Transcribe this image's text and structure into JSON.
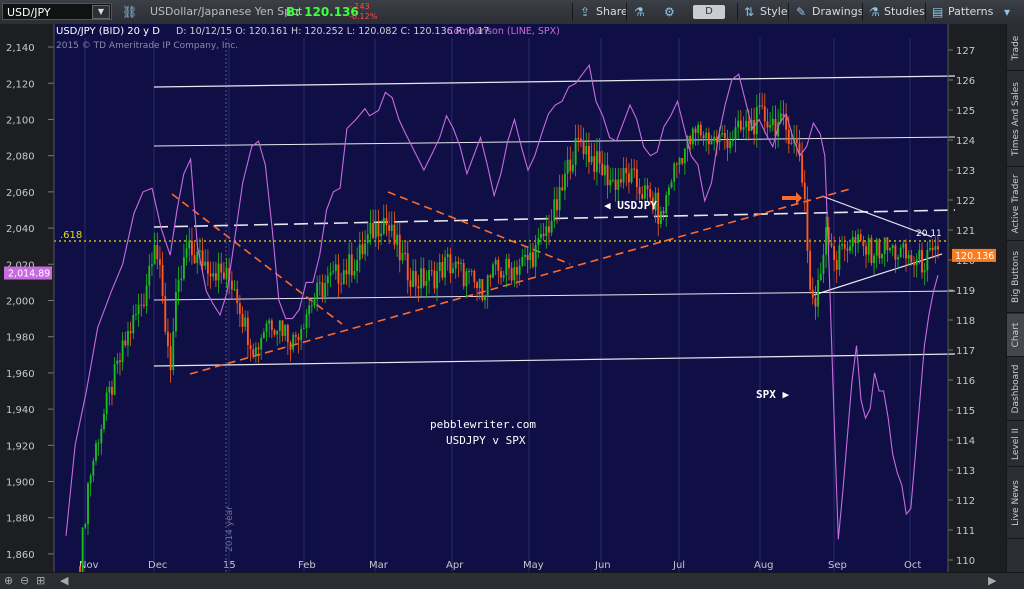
{
  "toolbar": {
    "symbol": "USD/JPY",
    "description": "USDollar/Japanese Yen Spot",
    "bid": "B: 120.136",
    "change_abs": "-.143",
    "change_pct": "-0.12%",
    "share": "Share",
    "period": "D",
    "style": "Style",
    "drawings": "Drawings",
    "studies": "Studies",
    "patterns": "Patterns"
  },
  "sidebar": {
    "tabs": [
      "Trade",
      "Times And Sales",
      "Active Trader",
      "Big Buttons",
      "Chart",
      "Dashboard",
      "Level II",
      "Live News"
    ],
    "active": "Chart"
  },
  "colors": {
    "plot_bg": "#0f0e45",
    "up": "#1bbf1b",
    "down": "#ff5a1a",
    "comparison": "#c86be0",
    "trend_red": "#ff6a2a",
    "trend_white": "#ffffff",
    "yellow": "#e8e000",
    "price_label_bg": "#ff7a1a"
  },
  "chart_data": {
    "type": "candlestick",
    "header": "USD/JPY (BID) 20 y D",
    "header_stats": "D: 10/12/15   O: 120.161   H: 120.252   L: 120.082   C: 120.136   R: 0.17",
    "comparison_label": "Comparison (LINE, SPX)",
    "copyright": "2015 © TD Ameritrade IP Company, Inc.",
    "x_labels": [
      "Nov",
      "Dec",
      "15",
      "Feb",
      "Mar",
      "Apr",
      "May",
      "Jun",
      "Jul",
      "Aug",
      "Sep",
      "Oct"
    ],
    "left_axis": {
      "ticks": [
        "2,140",
        "2,120",
        "2,100",
        "2,080",
        "2,060",
        "2,040",
        "2,020",
        "2,000",
        "1,980",
        "1,960",
        "1,940",
        "1,920",
        "1,900",
        "1,880",
        "1,860"
      ],
      "range": [
        1850,
        2145
      ],
      "current_label": "2,014.89"
    },
    "right_axis": {
      "ticks": [
        "127",
        "126",
        "125",
        "124",
        "123",
        "122",
        "121",
        "120",
        "119",
        "118",
        "117",
        "116",
        "115",
        "114",
        "113",
        "112",
        "111",
        "110"
      ],
      "range": [
        109.6,
        127.4
      ],
      "current_label": "120.136"
    },
    "annotations": {
      "fib_618": ".618",
      "usdjpy_label": "USDJPY",
      "spx_label": "SPX",
      "source": "pebblewriter.com",
      "subtitle": "USDJPY v SPX",
      "year_mark": "2014 year",
      "last_val": "20.11"
    },
    "spx_series": [
      [
        0,
        1870
      ],
      [
        4,
        1920
      ],
      [
        9,
        1950
      ],
      [
        14,
        1985
      ],
      [
        20,
        2005
      ],
      [
        25,
        2020
      ],
      [
        30,
        2048
      ],
      [
        34,
        2060
      ],
      [
        38,
        2062
      ],
      [
        42,
        2040
      ],
      [
        46,
        2025
      ],
      [
        49,
        2050
      ],
      [
        52,
        2070
      ],
      [
        55,
        2078
      ],
      [
        58,
        2030
      ],
      [
        62,
        2005
      ],
      [
        65,
        1998
      ],
      [
        68,
        1992
      ],
      [
        71,
        2004
      ],
      [
        74,
        2030
      ],
      [
        78,
        2065
      ],
      [
        82,
        2085
      ],
      [
        85,
        2088
      ],
      [
        88,
        2075
      ],
      [
        91,
        2040
      ],
      [
        94,
        2000
      ],
      [
        97,
        1990
      ],
      [
        100,
        1990
      ],
      [
        103,
        1995
      ],
      [
        106,
        2010
      ],
      [
        109,
        2010
      ],
      [
        112,
        2025
      ],
      [
        115,
        2050
      ],
      [
        118,
        2060
      ],
      [
        121,
        2062
      ],
      [
        124,
        2095
      ],
      [
        128,
        2100
      ],
      [
        132,
        2106
      ],
      [
        134,
        2102
      ],
      [
        138,
        2105
      ],
      [
        141,
        2115
      ],
      [
        144,
        2112
      ],
      [
        147,
        2100
      ],
      [
        150,
        2092
      ],
      [
        154,
        2082
      ],
      [
        158,
        2072
      ],
      [
        162,
        2082
      ],
      [
        165,
        2090
      ],
      [
        168,
        2102
      ],
      [
        171,
        2095
      ],
      [
        174,
        2085
      ],
      [
        177,
        2070
      ],
      [
        180,
        2080
      ],
      [
        183,
        2090
      ],
      [
        186,
        2075
      ],
      [
        189,
        2058
      ],
      [
        192,
        2070
      ],
      [
        195,
        2088
      ],
      [
        198,
        2100
      ],
      [
        201,
        2085
      ],
      [
        204,
        2072
      ],
      [
        207,
        2080
      ],
      [
        210,
        2092
      ],
      [
        213,
        2103
      ],
      [
        216,
        2108
      ],
      [
        219,
        2110
      ],
      [
        222,
        2118
      ],
      [
        225,
        2120
      ],
      [
        228,
        2125
      ],
      [
        231,
        2130
      ],
      [
        234,
        2110
      ],
      [
        237,
        2102
      ],
      [
        240,
        2090
      ],
      [
        243,
        2088
      ],
      [
        246,
        2098
      ],
      [
        249,
        2108
      ],
      [
        252,
        2100
      ],
      [
        255,
        2085
      ],
      [
        258,
        2080
      ],
      [
        261,
        2082
      ],
      [
        264,
        2096
      ],
      [
        267,
        2102
      ],
      [
        270,
        2110
      ],
      [
        273,
        2095
      ],
      [
        276,
        2080
      ],
      [
        279,
        2075
      ],
      [
        282,
        2055
      ],
      [
        285,
        2065
      ],
      [
        288,
        2090
      ],
      [
        291,
        2108
      ],
      [
        294,
        2122
      ],
      [
        297,
        2125
      ],
      [
        300,
        2110
      ],
      [
        303,
        2095
      ],
      [
        306,
        2100
      ],
      [
        309,
        2092
      ],
      [
        312,
        2085
      ],
      [
        315,
        2098
      ],
      [
        318,
        2103
      ],
      [
        321,
        2090
      ],
      [
        324,
        2080
      ],
      [
        327,
        2085
      ],
      [
        330,
        2098
      ],
      [
        333,
        2092
      ],
      [
        335,
        2080
      ],
      [
        337,
        2015
      ],
      [
        339,
        1940
      ],
      [
        341,
        1868
      ],
      [
        343,
        1895
      ],
      [
        345,
        1925
      ],
      [
        347,
        1955
      ],
      [
        349,
        1975
      ],
      [
        351,
        1945
      ],
      [
        353,
        1935
      ],
      [
        355,
        1940
      ],
      [
        357,
        1960
      ],
      [
        359,
        1950
      ],
      [
        361,
        1950
      ],
      [
        363,
        1935
      ],
      [
        365,
        1915
      ],
      [
        367,
        1905
      ],
      [
        369,
        1898
      ],
      [
        371,
        1882
      ],
      [
        373,
        1885
      ],
      [
        375,
        1915
      ],
      [
        377,
        1945
      ],
      [
        379,
        1975
      ],
      [
        381,
        1992
      ],
      [
        383,
        2005
      ],
      [
        385,
        2014
      ]
    ]
  }
}
